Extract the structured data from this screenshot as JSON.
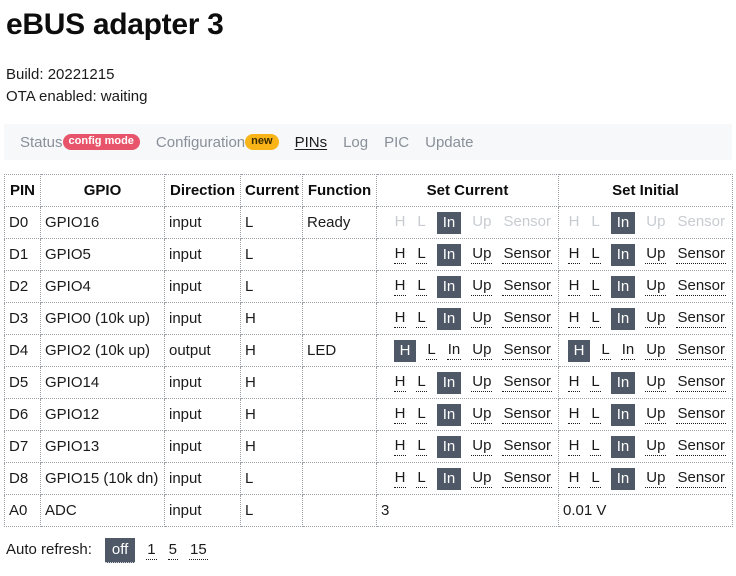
{
  "header": {
    "title": "eBUS adapter 3",
    "build_label": "Build: 20221215",
    "ota_label": "OTA enabled: waiting"
  },
  "nav": {
    "items": [
      {
        "label": "Status",
        "badge": "config mode",
        "badge_kind": "danger",
        "active": false
      },
      {
        "label": "Configuration",
        "badge": "new",
        "badge_kind": "warn",
        "active": false
      },
      {
        "label": "PINs",
        "badge": "",
        "badge_kind": "",
        "active": true
      },
      {
        "label": "Log",
        "badge": "",
        "badge_kind": "",
        "active": false
      },
      {
        "label": "PIC",
        "badge": "",
        "badge_kind": "",
        "active": false
      },
      {
        "label": "Update",
        "badge": "",
        "badge_kind": "",
        "active": false
      }
    ]
  },
  "table": {
    "columns": [
      "PIN",
      "GPIO",
      "Direction",
      "Current",
      "Function",
      "Set Current",
      "Set Initial"
    ],
    "actions": [
      "H",
      "L",
      "In",
      "Up",
      "Sensor"
    ],
    "rows": [
      {
        "pin": "D0",
        "gpio": "GPIO16",
        "direction": "input",
        "current": "L",
        "function": "Ready",
        "disabled": true,
        "set_current": "In",
        "set_initial": "In"
      },
      {
        "pin": "D1",
        "gpio": "GPIO5",
        "direction": "input",
        "current": "L",
        "function": "",
        "disabled": false,
        "set_current": "In",
        "set_initial": "In"
      },
      {
        "pin": "D2",
        "gpio": "GPIO4",
        "direction": "input",
        "current": "L",
        "function": "",
        "disabled": false,
        "set_current": "In",
        "set_initial": "In"
      },
      {
        "pin": "D3",
        "gpio": "GPIO0 (10k up)",
        "direction": "input",
        "current": "H",
        "function": "",
        "disabled": false,
        "set_current": "In",
        "set_initial": "In"
      },
      {
        "pin": "D4",
        "gpio": "GPIO2 (10k up)",
        "direction": "output",
        "current": "H",
        "function": "LED",
        "disabled": false,
        "set_current": "H",
        "set_initial": "H"
      },
      {
        "pin": "D5",
        "gpio": "GPIO14",
        "direction": "input",
        "current": "H",
        "function": "",
        "disabled": false,
        "set_current": "In",
        "set_initial": "In"
      },
      {
        "pin": "D6",
        "gpio": "GPIO12",
        "direction": "input",
        "current": "H",
        "function": "",
        "disabled": false,
        "set_current": "In",
        "set_initial": "In"
      },
      {
        "pin": "D7",
        "gpio": "GPIO13",
        "direction": "input",
        "current": "H",
        "function": "",
        "disabled": false,
        "set_current": "In",
        "set_initial": "In"
      },
      {
        "pin": "D8",
        "gpio": "GPIO15 (10k dn)",
        "direction": "input",
        "current": "L",
        "function": "",
        "disabled": false,
        "set_current": "In",
        "set_initial": "In"
      }
    ],
    "adc_row": {
      "pin": "A0",
      "gpio": "ADC",
      "direction": "input",
      "current": "L",
      "function": "",
      "set_current_value": "3",
      "set_initial_value": "0.01 V"
    }
  },
  "footer": {
    "label": "Auto refresh:",
    "options": [
      "off",
      "1",
      "5",
      "15"
    ],
    "selected": "off"
  },
  "colors": {
    "selected_bg": "#4f5866",
    "nav_bg": "#f6f8fa",
    "badge_danger": "#e8556a",
    "badge_warn": "#f9b418",
    "disabled_text": "#c8ccd1"
  }
}
